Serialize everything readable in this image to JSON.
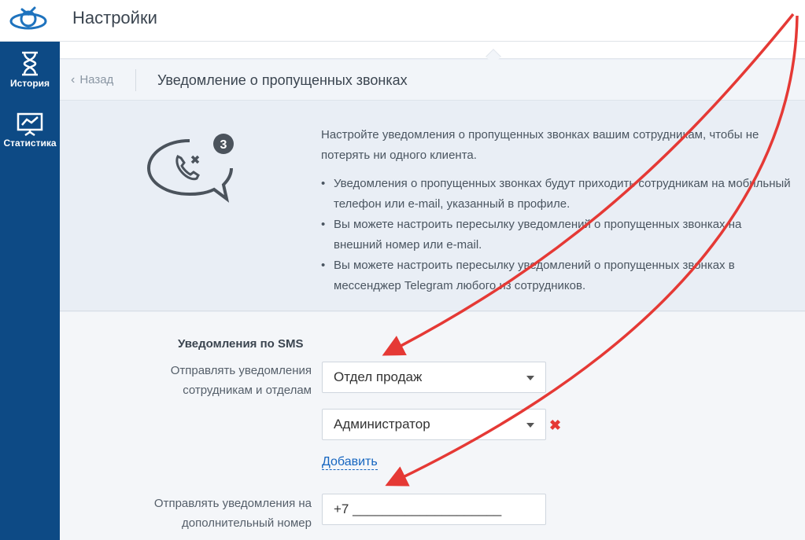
{
  "header": {
    "title": "Настройки",
    "logo_icon": "satellite-logo-icon"
  },
  "sidebar": {
    "items": [
      {
        "label": "История",
        "icon": "hourglass-icon"
      },
      {
        "label": "Статистика",
        "icon": "chart-board-icon"
      }
    ]
  },
  "breadcrumb": {
    "back_label": "Назад",
    "page_title": "Уведомление о пропущенных звонках"
  },
  "intro": {
    "icon": "missed-call-bubble-icon",
    "badge_count": "3",
    "lead": "Настройте уведомления о пропущенных звонках вашим сотрудникам, чтобы не потерять ни одного клиента.",
    "bullets": [
      "Уведомления о пропущенных звонках будут приходить сотрудникам на мобильный телефон или e-mail, указанный в профиле.",
      "Вы можете настроить пересылку уведомлений о пропущенных звонках на внешний номер или e-mail.",
      "Вы можете настроить пересылку уведомлений о пропущенных звонках в мессенджер Telegram любого из сотрудников."
    ]
  },
  "sms": {
    "section_label": "Уведомления по SMS",
    "send_to_label": "Отправлять уведомления сотрудникам и отделам",
    "recipients": [
      "Отдел продаж",
      "Администратор"
    ],
    "remove_symbol": "✖",
    "add_label": "Добавить",
    "extra_number_label": "Отправлять уведомления на дополнительный номер",
    "extra_number_value": "+7 ____________________"
  },
  "colors": {
    "sidebar": "#0d4a85",
    "accent": "#1565c0",
    "arrow": "#e53935"
  }
}
